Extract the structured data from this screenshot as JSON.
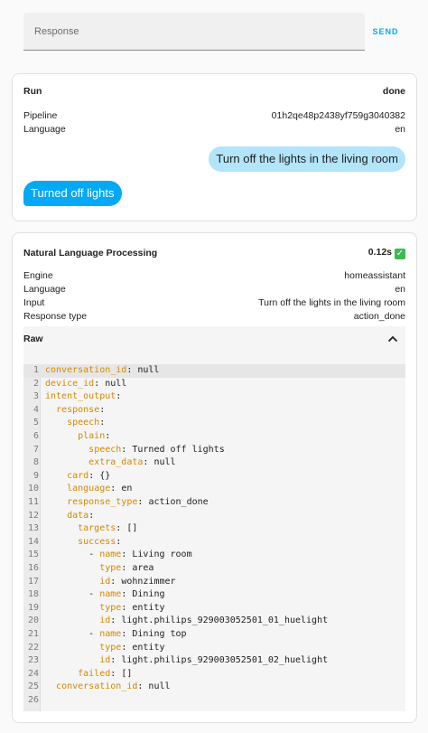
{
  "response_input": {
    "placeholder": "Response",
    "send_label": "SEND"
  },
  "run": {
    "title": "Run",
    "status": "done",
    "pipeline_label": "Pipeline",
    "pipeline_value": "01h2qe48p2438yf759g3040382",
    "language_label": "Language",
    "language_value": "en",
    "user_message": "Turn off the lights in the living room",
    "bot_message": "Turned off lights"
  },
  "nlp": {
    "title": "Natural Language Processing",
    "duration": "0.12s",
    "check_glyph": "✓",
    "engine_label": "Engine",
    "engine_value": "homeassistant",
    "language_label": "Language",
    "language_value": "en",
    "input_label": "Input",
    "input_value": "Turn off the lights in the living room",
    "response_type_label": "Response type",
    "response_type_value": "action_done",
    "raw_title": "Raw",
    "raw_lines": [
      {
        "num": "1",
        "indent": "",
        "key": "conversation_id",
        "dash": false,
        "value": "null"
      },
      {
        "num": "2",
        "indent": "",
        "key": "device_id",
        "dash": false,
        "value": "null"
      },
      {
        "num": "3",
        "indent": "",
        "key": "intent_output",
        "dash": false,
        "value": ""
      },
      {
        "num": "4",
        "indent": "  ",
        "key": "response",
        "dash": false,
        "value": ""
      },
      {
        "num": "5",
        "indent": "    ",
        "key": "speech",
        "dash": false,
        "value": ""
      },
      {
        "num": "6",
        "indent": "      ",
        "key": "plain",
        "dash": false,
        "value": ""
      },
      {
        "num": "7",
        "indent": "        ",
        "key": "speech",
        "dash": false,
        "value": "Turned off lights"
      },
      {
        "num": "8",
        "indent": "        ",
        "key": "extra_data",
        "dash": false,
        "value": "null"
      },
      {
        "num": "9",
        "indent": "    ",
        "key": "card",
        "dash": false,
        "value": "{}"
      },
      {
        "num": "10",
        "indent": "    ",
        "key": "language",
        "dash": false,
        "value": "en"
      },
      {
        "num": "11",
        "indent": "    ",
        "key": "response_type",
        "dash": false,
        "value": "action_done"
      },
      {
        "num": "12",
        "indent": "    ",
        "key": "data",
        "dash": false,
        "value": ""
      },
      {
        "num": "13",
        "indent": "      ",
        "key": "targets",
        "dash": false,
        "value": "[]"
      },
      {
        "num": "14",
        "indent": "      ",
        "key": "success",
        "dash": false,
        "value": ""
      },
      {
        "num": "15",
        "indent": "        ",
        "key": "name",
        "dash": true,
        "value": "Living room"
      },
      {
        "num": "16",
        "indent": "          ",
        "key": "type",
        "dash": false,
        "value": "area"
      },
      {
        "num": "17",
        "indent": "          ",
        "key": "id",
        "dash": false,
        "value": "wohnzimmer"
      },
      {
        "num": "18",
        "indent": "        ",
        "key": "name",
        "dash": true,
        "value": "Dining"
      },
      {
        "num": "19",
        "indent": "          ",
        "key": "type",
        "dash": false,
        "value": "entity"
      },
      {
        "num": "20",
        "indent": "          ",
        "key": "id",
        "dash": false,
        "value": "light.philips_929003052501_01_huelight"
      },
      {
        "num": "21",
        "indent": "        ",
        "key": "name",
        "dash": true,
        "value": "Dining top"
      },
      {
        "num": "22",
        "indent": "          ",
        "key": "type",
        "dash": false,
        "value": "entity"
      },
      {
        "num": "23",
        "indent": "          ",
        "key": "id",
        "dash": false,
        "value": "light.philips_929003052501_02_huelight"
      },
      {
        "num": "24",
        "indent": "      ",
        "key": "failed",
        "dash": false,
        "value": "[]"
      },
      {
        "num": "25",
        "indent": "  ",
        "key": "conversation_id",
        "dash": false,
        "value": "null"
      },
      {
        "num": "26",
        "indent": "",
        "key": "",
        "dash": false,
        "value": ""
      }
    ]
  },
  "colors": {
    "accent": "#03a9f4",
    "user_bubble": "#b2e4fa",
    "yaml_key": "#d28800",
    "check": "#3fb950"
  },
  "icons": {
    "collapse": "chevron-up-icon",
    "done": "check-icon"
  }
}
